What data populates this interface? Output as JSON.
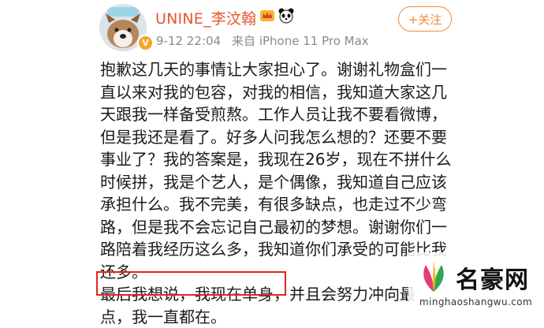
{
  "post": {
    "username": "UNINE_李汶翰",
    "time": "9-12 22:04",
    "source": "来自 iPhone 11 Pro Max",
    "follow_label": "+关注",
    "avatar_badge": "V",
    "lines": [
      "抱歉这几天的事情让大家担心了。谢谢礼物盒们一",
      "直以来对我的包容，对我的相信，我知道大家这几",
      "天跟我一样备受煎熬。工作人员让我不要看微博，",
      "但是我还是看了。好多人问我怎么想的？还要不要",
      "事业了？我的答案是，我现在26岁，现在不拼什么",
      "时候拼，我是个艺人，是个偶像，我知道自己应该",
      "承担什么。我不完美，有很多缺点，也走过不少弯",
      "路，但是我不会忘记自己最初的梦想。谢谢你们一",
      "路陪着我经历这么多，我知道你们承受的可能比我",
      "还多。"
    ],
    "highlighted_text": "最后我想说，我现在单身",
    "continued_text": "，并且会努力冲向最",
    "final_line": "点，我一直都在。"
  },
  "watermark": {
    "name": "名豪网",
    "url": "minghaoshangwu.com"
  },
  "colors": {
    "username": "#e4572e",
    "follow": "#f08a3c",
    "highlight_border": "#e0261f",
    "meta": "#8a8a8a"
  }
}
